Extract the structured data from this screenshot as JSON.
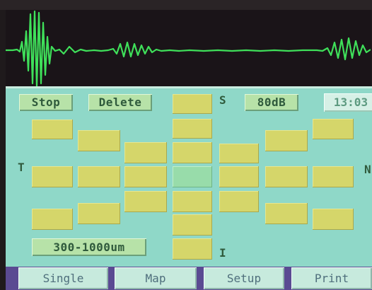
{
  "controls": {
    "stop_label": "Stop",
    "delete_label": "Delete",
    "level_label": "80dB",
    "clock": "13:03",
    "range_label": "300-1000um"
  },
  "markers": {
    "top": "S",
    "bottom": "I",
    "left": "T",
    "right": "N"
  },
  "tabs": [
    "Single",
    "Map",
    "Setup",
    "Print"
  ],
  "colors": {
    "panel": "#8fd8c8",
    "cell": "#d5d66a",
    "center_cell": "#98dcaa",
    "tab_bar": "#5a4a92",
    "waveform": "#3fe05a"
  }
}
